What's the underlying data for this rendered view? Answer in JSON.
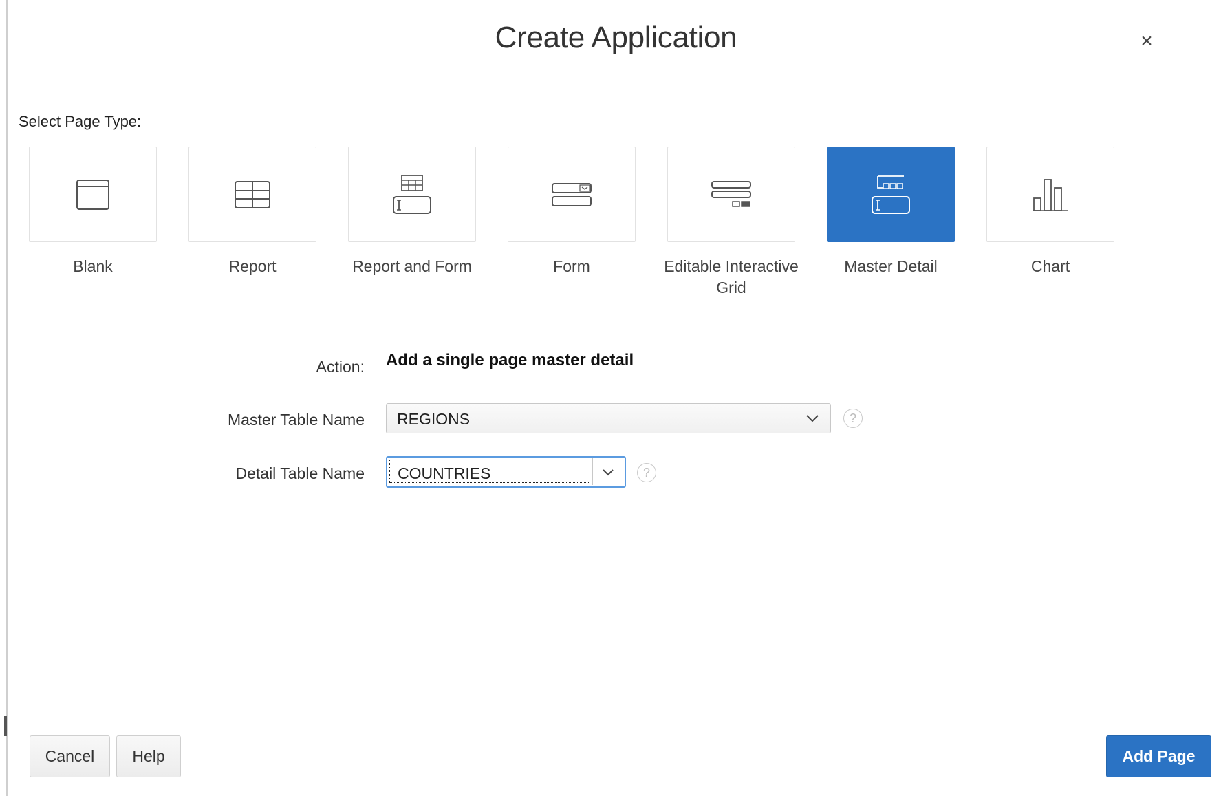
{
  "dialog": {
    "title": "Create Application",
    "close_label": "×"
  },
  "page_types": {
    "label": "Select Page Type:",
    "items": [
      {
        "label": "Blank",
        "icon": "blank-page-icon",
        "selected": false
      },
      {
        "label": "Report",
        "icon": "report-icon",
        "selected": false
      },
      {
        "label": "Report and Form",
        "icon": "report-and-form-icon",
        "selected": false
      },
      {
        "label": "Form",
        "icon": "form-icon",
        "selected": false
      },
      {
        "label": "Editable Interactive Grid",
        "icon": "editable-grid-icon",
        "selected": false
      },
      {
        "label": "Master Detail",
        "icon": "master-detail-icon",
        "selected": true
      },
      {
        "label": "Chart",
        "icon": "chart-icon",
        "selected": false
      }
    ]
  },
  "form": {
    "action_label": "Action:",
    "action_value": "Add a single page master detail",
    "master_table_label": "Master Table Name",
    "master_table_value": "REGIONS",
    "detail_table_label": "Detail Table Name",
    "detail_table_value": "COUNTRIES",
    "help_glyph": "?"
  },
  "footer": {
    "cancel_label": "Cancel",
    "help_label": "Help",
    "add_page_label": "Add Page"
  },
  "colors": {
    "accent": "#2b73c4",
    "icon_stroke": "#555555",
    "selected_icon_stroke": "#ffffff"
  }
}
